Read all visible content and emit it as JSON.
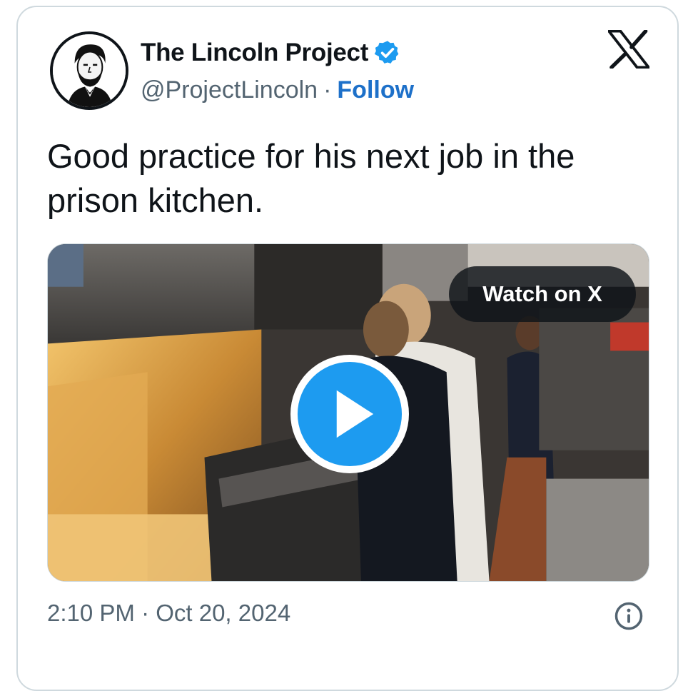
{
  "author": {
    "display_name": "The Lincoln Project",
    "handle": "@ProjectLincoln",
    "separator": "·",
    "follow_label": "Follow",
    "verified": true,
    "avatar_icon": "lincoln-portrait-icon"
  },
  "tweet": {
    "text": "Good practice for his next job in the prison kitchen."
  },
  "media": {
    "type": "video",
    "watch_label": "Watch on X",
    "play_icon": "play-icon"
  },
  "footer": {
    "timestamp": "2:10 PM · Oct 20, 2024",
    "info_icon": "info-icon"
  },
  "colors": {
    "follow_link": "#1d70c9",
    "verified_badge": "#1d9bf0",
    "play_button": "#1d9bf0",
    "text_primary": "#0f1419",
    "text_secondary": "#536471"
  }
}
